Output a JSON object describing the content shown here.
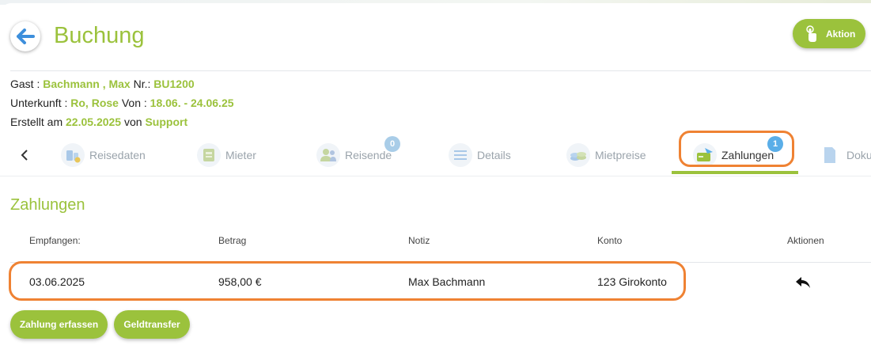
{
  "header": {
    "title": "Buchung",
    "action_label": "Aktion"
  },
  "info": {
    "gast_label": "Gast : ",
    "gast_value": "Bachmann , Max",
    "nr_label": " Nr.: ",
    "nr_value": "BU1200",
    "unterkunft_label": "Unterkunft : ",
    "unterkunft_value": "Ro, Rose",
    "von_label": " Von : ",
    "von_value": "18.06. - 24.06.25",
    "erstellt_label": "Erstellt am ",
    "erstellt_value": "22.05.2025",
    "von2_label": " von ",
    "von2_value": "Support"
  },
  "tabs": [
    {
      "label": "Reisedaten",
      "icon": "luggage-icon"
    },
    {
      "label": "Mieter",
      "icon": "id-card-icon"
    },
    {
      "label": "Reisende",
      "icon": "people-icon",
      "badge": "0"
    },
    {
      "label": "Details",
      "icon": "list-icon"
    },
    {
      "label": "Mietpreise",
      "icon": "coins-icon"
    },
    {
      "label": "Zahlungen",
      "icon": "payment-card-icon",
      "badge": "1",
      "active": true
    },
    {
      "label": "Doku",
      "icon": "document-icon"
    }
  ],
  "section": {
    "title": "Zahlungen",
    "columns": [
      "Empfangen:",
      "Betrag",
      "Notiz",
      "Konto",
      "Aktionen"
    ],
    "rows": [
      {
        "empfangen": "03.06.2025",
        "betrag": "958,00 €",
        "notiz": "Max Bachmann",
        "konto": "123 Girokonto"
      }
    ]
  },
  "buttons": {
    "zahlung_erfassen": "Zahlung erfassen",
    "geldtransfer": "Geldtransfer"
  },
  "colors": {
    "accent": "#9bc23c",
    "highlight": "#ef8233",
    "badge": "#5aaee8",
    "back_arrow": "#3d8fdc"
  }
}
